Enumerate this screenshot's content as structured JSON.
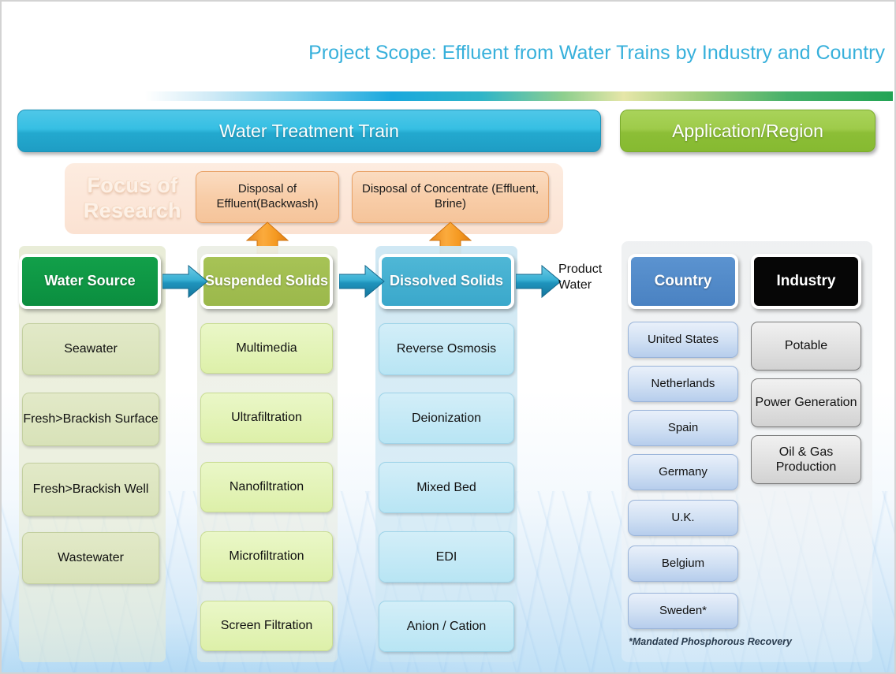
{
  "title": "Project Scope: Effluent from Water Trains by Industry and Country",
  "top_bars": {
    "water_treatment_train": "Water Treatment Train",
    "application_region": "Application/Region"
  },
  "focus": {
    "label_line1": "Focus of",
    "label_line2": "Research",
    "boxes": [
      "Disposal of Effluent(Backwash)",
      "Disposal of Concentrate (Effluent, Brine)"
    ]
  },
  "columns": [
    {
      "header": "Water Source",
      "items": [
        "Seawater",
        "Fresh>Brackish Surface",
        "Fresh>Brackish Well",
        "Wastewater"
      ]
    },
    {
      "header": "Suspended Solids",
      "items": [
        "Multimedia",
        "Ultrafiltration",
        "Nanofiltration",
        "Microfiltration",
        "Screen Filtration"
      ]
    },
    {
      "header": "Dissolved Solids",
      "items": [
        "Reverse Osmosis",
        "Deionization",
        "Mixed Bed",
        "EDI",
        "Anion / Cation"
      ]
    }
  ],
  "output": {
    "label": "Product Water"
  },
  "right": {
    "country": {
      "header": "Country",
      "items": [
        "United States",
        "Netherlands",
        "Spain",
        "Germany",
        "U.K.",
        "Belgium",
        "Sweden*"
      ]
    },
    "industry": {
      "header": "Industry",
      "items": [
        "Potable",
        "Power Generation",
        "Oil & Gas Production"
      ]
    },
    "footnote": "*Mandated Phosphorous Recovery"
  },
  "colors": {
    "title": "#37b0db",
    "train_bar": "#2bb4da",
    "app_bar": "#9ecb4a",
    "water_source": "#0f9d47",
    "suspended": "#a7c356",
    "dissolved": "#45b0d0",
    "country": "#4f88c8",
    "industry": "#060606",
    "disposal": "#f5c49a",
    "arrow_orange": "#f0921e",
    "arrow_blue": "#2a9fc4"
  }
}
